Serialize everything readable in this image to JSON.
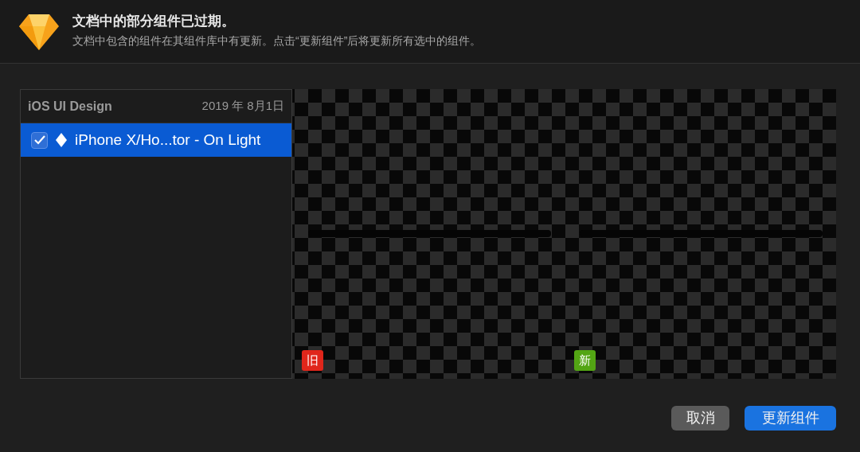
{
  "header": {
    "title": "文档中的部分组件已过期。",
    "message": "文档中包含的组件在其组件库中有更新。点击“更新组件”后将更新所有选中的组件。"
  },
  "library": {
    "name": "iOS UI Design",
    "date": "2019 年 8月1日"
  },
  "items": [
    {
      "label": "iPhone X/Ho...tor - On Light",
      "checked": true,
      "selected": true
    }
  ],
  "preview": {
    "badges": [
      {
        "label": "旧",
        "color": "#e0261b"
      },
      {
        "label": "新",
        "color": "#53a514"
      }
    ]
  },
  "buttons": [
    {
      "label": "取消",
      "kind": "secondary"
    },
    {
      "label": "更新组件",
      "kind": "primary"
    }
  ]
}
